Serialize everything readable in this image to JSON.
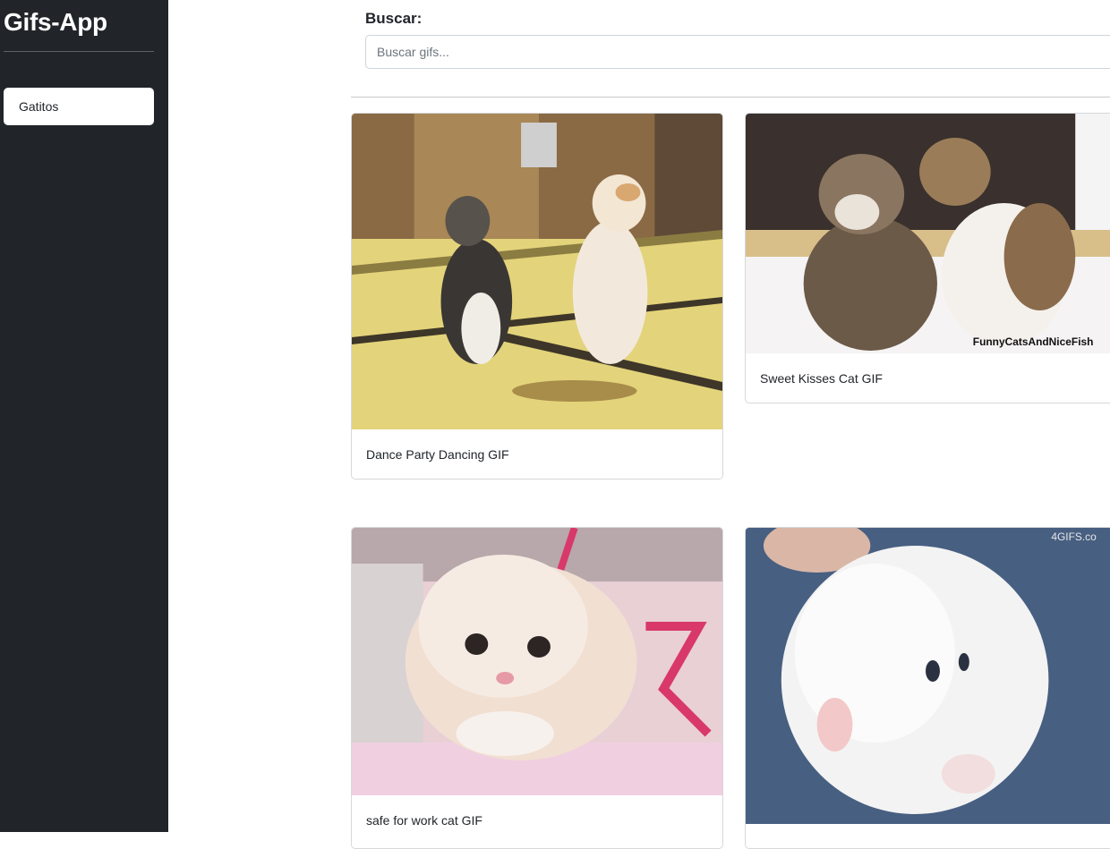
{
  "app": {
    "title": "Gifs-App"
  },
  "sidebar": {
    "history": [
      {
        "label": "Gatitos"
      }
    ]
  },
  "search": {
    "label": "Buscar:",
    "placeholder": "Buscar gifs...",
    "value": ""
  },
  "results": {
    "cards": [
      {
        "title": "Dance Party Dancing GIF",
        "image": "two kittens dancing on tatami mat",
        "watermark": ""
      },
      {
        "title": "Sweet Kisses Cat GIF",
        "image": "two kittens kissing on white blanket",
        "watermark": "FunnyCatsAndNiceFish"
      },
      {
        "title": "safe for work cat GIF",
        "image": "fluffy cream kitten on pink towel",
        "watermark": ""
      },
      {
        "title": "",
        "image": "white kitten held on denim",
        "watermark": "4GIFS.co"
      }
    ]
  },
  "colors": {
    "sidebar_bg": "#212529",
    "text": "#212529",
    "border": "#d6d8db"
  }
}
